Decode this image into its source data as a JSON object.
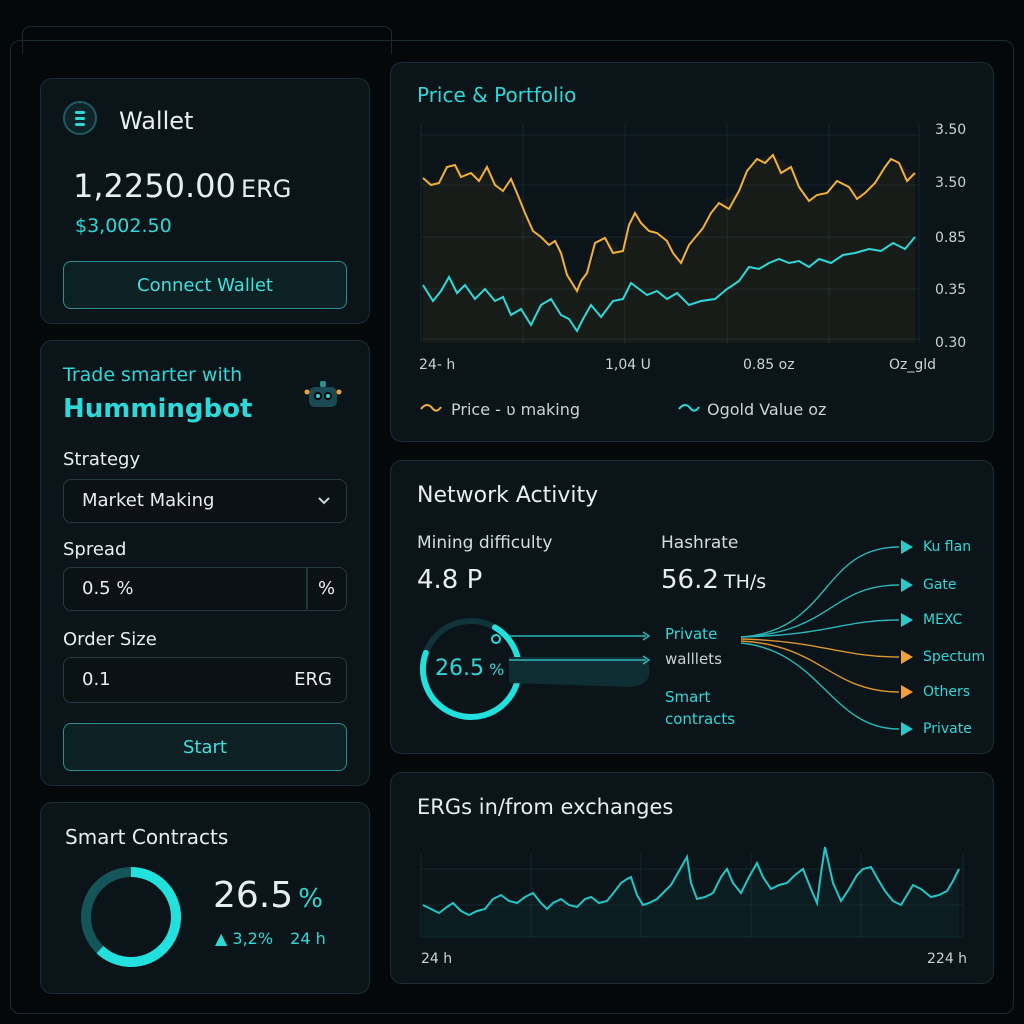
{
  "wallet": {
    "title": "Wallet",
    "balance": "1,2250.00",
    "unit": "ERG",
    "usd": "$3,002.50",
    "connect_label": "Connect Wallet"
  },
  "trade": {
    "tagline": "Trade smarter with",
    "brand": "Hummingbot",
    "strategy_label": "Strategy",
    "strategy_value": "Market Making",
    "spread_label": "Spread",
    "spread_value": "0.5 %",
    "spread_unit": "%",
    "order_label": "Order Size",
    "order_value": "0.1",
    "order_unit": "ERG",
    "start_label": "Start"
  },
  "contracts": {
    "title": "Smart Contracts",
    "percent": "26.5",
    "percent_sign": "%",
    "change": "3,2%",
    "period": "24 h",
    "ring_fraction": 0.62
  },
  "price": {
    "title": "Price & Portfolio",
    "y_ticks": [
      "3.50",
      "3.50",
      "0.85",
      "0.35",
      "0.30"
    ],
    "x_ticks": [
      "24- h",
      "1,04 U",
      "0.85 oz",
      "Oz_gld"
    ],
    "legend_a": "Price - ʋ making",
    "legend_b": "Ogold Value oz"
  },
  "network": {
    "title": "Network Activity",
    "difficulty_label": "Mining difficulty",
    "difficulty_value": "4.8 P",
    "hashrate_label": "Hashrate",
    "hashrate_value": "56.2",
    "hashrate_unit": "TH/s",
    "gauge_value": "26.5",
    "gauge_sign": "%",
    "gauge_fraction": 0.72,
    "flow_private": "Private",
    "flow_wallets": "walllets",
    "flow_smart": "Smart",
    "flow_contracts": "contracts",
    "destinations": [
      {
        "label": "Ku flan",
        "color": "#2ec8c8"
      },
      {
        "label": "Gate",
        "color": "#2ec8c8"
      },
      {
        "label": "MEXC",
        "color": "#2ec8c8"
      },
      {
        "label": "Spectum",
        "color": "#f2a03a"
      },
      {
        "label": "Others",
        "color": "#f2a03a"
      },
      {
        "label": "Private",
        "color": "#2ec8c8"
      }
    ]
  },
  "exchanges": {
    "title": "ERGs in/from exchanges",
    "x_start": "24  h",
    "x_end": "224 h"
  },
  "colors": {
    "accent": "#2ed8d8",
    "orange": "#f2b03a",
    "background": "#05080b"
  }
}
